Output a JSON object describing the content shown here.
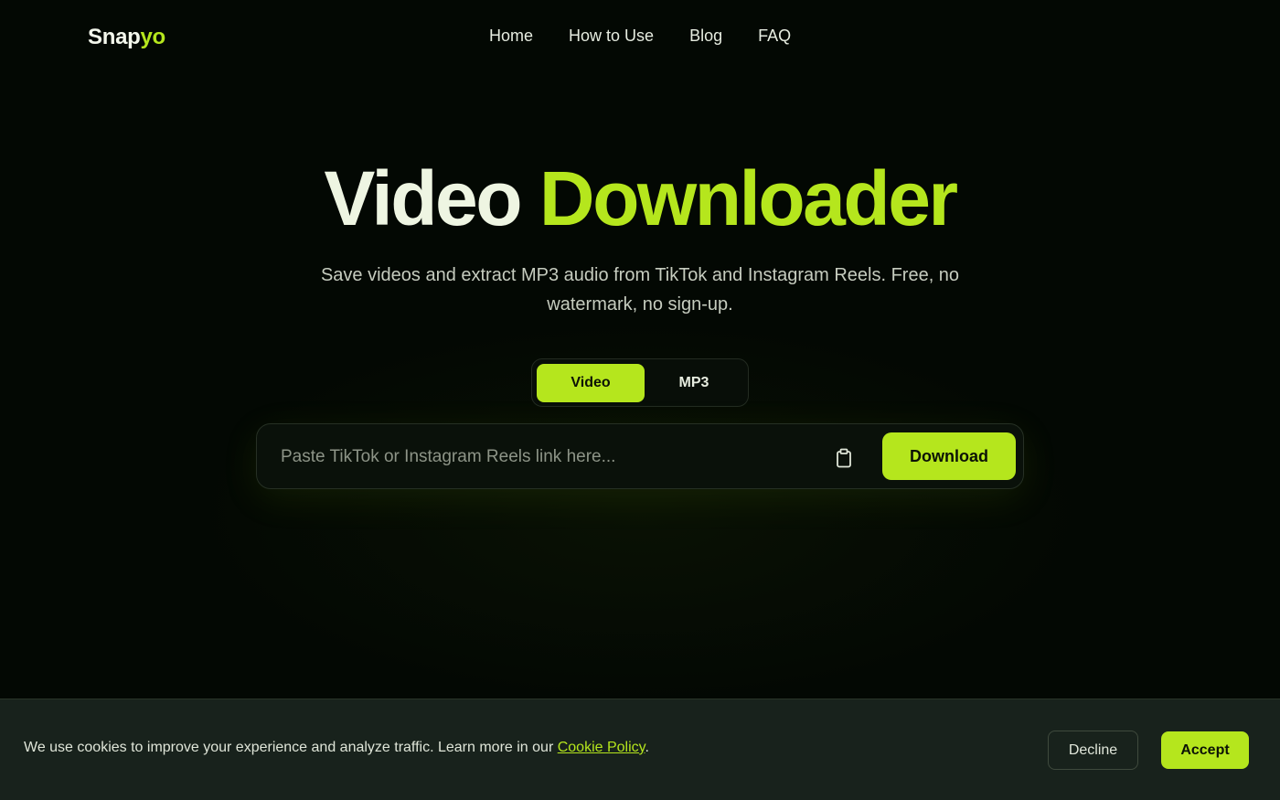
{
  "brand": {
    "part1": "Snap",
    "part2": "yo"
  },
  "nav": {
    "home": "Home",
    "how_to_use": "How to Use",
    "blog": "Blog",
    "faq": "FAQ"
  },
  "hero": {
    "title_part1": "Video",
    "title_part2": "Downloader",
    "subtitle": "Save videos and extract MP3 audio from TikTok and Instagram Reels. Free, no watermark, no sign-up."
  },
  "mode_toggle": {
    "options": [
      "Video",
      "MP3"
    ],
    "selected": "Video"
  },
  "search": {
    "placeholder": "Paste TikTok or Instagram Reels link here...",
    "value": "",
    "paste_icon": "clipboard-icon",
    "download_label": "Download"
  },
  "cookie_banner": {
    "text": "We use cookies to improve your experience and analyze traffic. Learn more in our ",
    "link_text": "Cookie Policy",
    "suffix": ".",
    "decline_label": "Decline",
    "accept_label": "Accept"
  },
  "colors": {
    "accent": "#b5e61d",
    "background": "#030803",
    "banner": "#18221c"
  }
}
